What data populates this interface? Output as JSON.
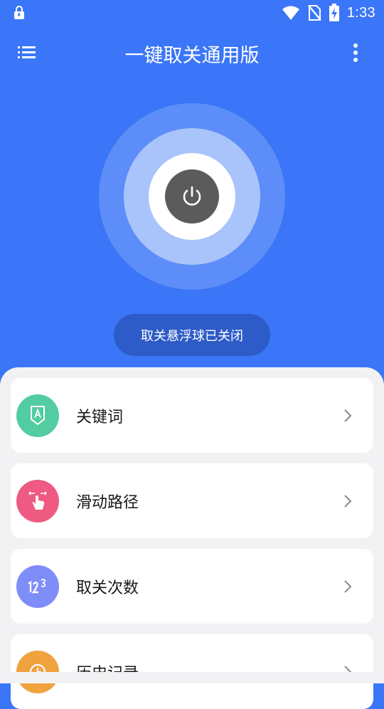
{
  "status_bar": {
    "time": "1:33"
  },
  "app_bar": {
    "title": "一键取关通用版",
    "menu_icon": "list-icon",
    "more_icon": "more-vert-icon"
  },
  "power": {
    "icon": "power-icon",
    "status_text": "取关悬浮球已关闭"
  },
  "menu_items": [
    {
      "label": "关键词",
      "icon": "keyword-icon",
      "color": "#52cca0"
    },
    {
      "label": "滑动路径",
      "icon": "swipe-gesture-icon",
      "color": "#ee5a81"
    },
    {
      "label": "取关次数",
      "icon": "numbers-icon",
      "color": "#7f8df8"
    },
    {
      "label": "历史记录",
      "icon": "clock-icon",
      "color": "#f0a23e"
    }
  ],
  "colors": {
    "header_bg": "#3a76f7",
    "pill_bg": "#2d5bc7",
    "sheet_bg": "#f2f2f4"
  }
}
